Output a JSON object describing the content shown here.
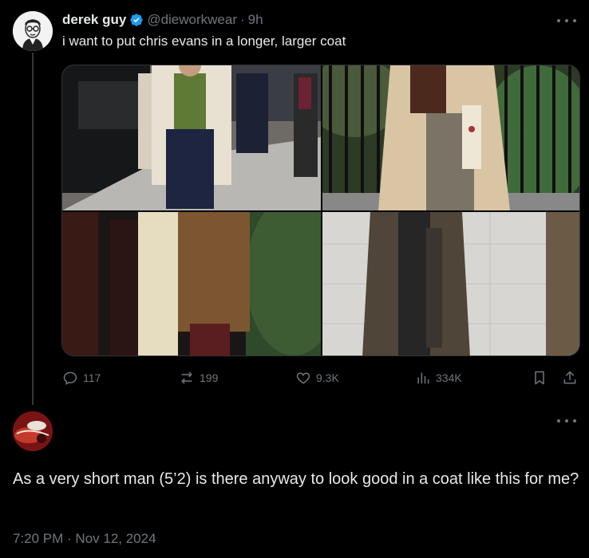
{
  "tweet": {
    "author_name": "derek guy",
    "handle": "@dieworkwear",
    "separator": "·",
    "time": "9h",
    "text": "i want to put chris evans in a longer, larger coat",
    "media_count": 4,
    "stats": {
      "replies": "117",
      "retweets": "199",
      "likes": "9.3K",
      "views": "334K"
    }
  },
  "reply": {
    "text": "As a very short man (5’2) is there anyway to look good in a coat like this for me?",
    "timestamp": "7:20 PM · Nov 12, 2024"
  },
  "colors": {
    "background": "#000000",
    "text_primary": "#e7e9ea",
    "text_secondary": "#71767b",
    "verified": "#1d9bf0",
    "divider": "#333639"
  },
  "icons": [
    "verified-badge-icon",
    "more-icon",
    "reply-icon",
    "retweet-icon",
    "like-icon",
    "views-icon",
    "bookmark-icon",
    "share-icon"
  ]
}
